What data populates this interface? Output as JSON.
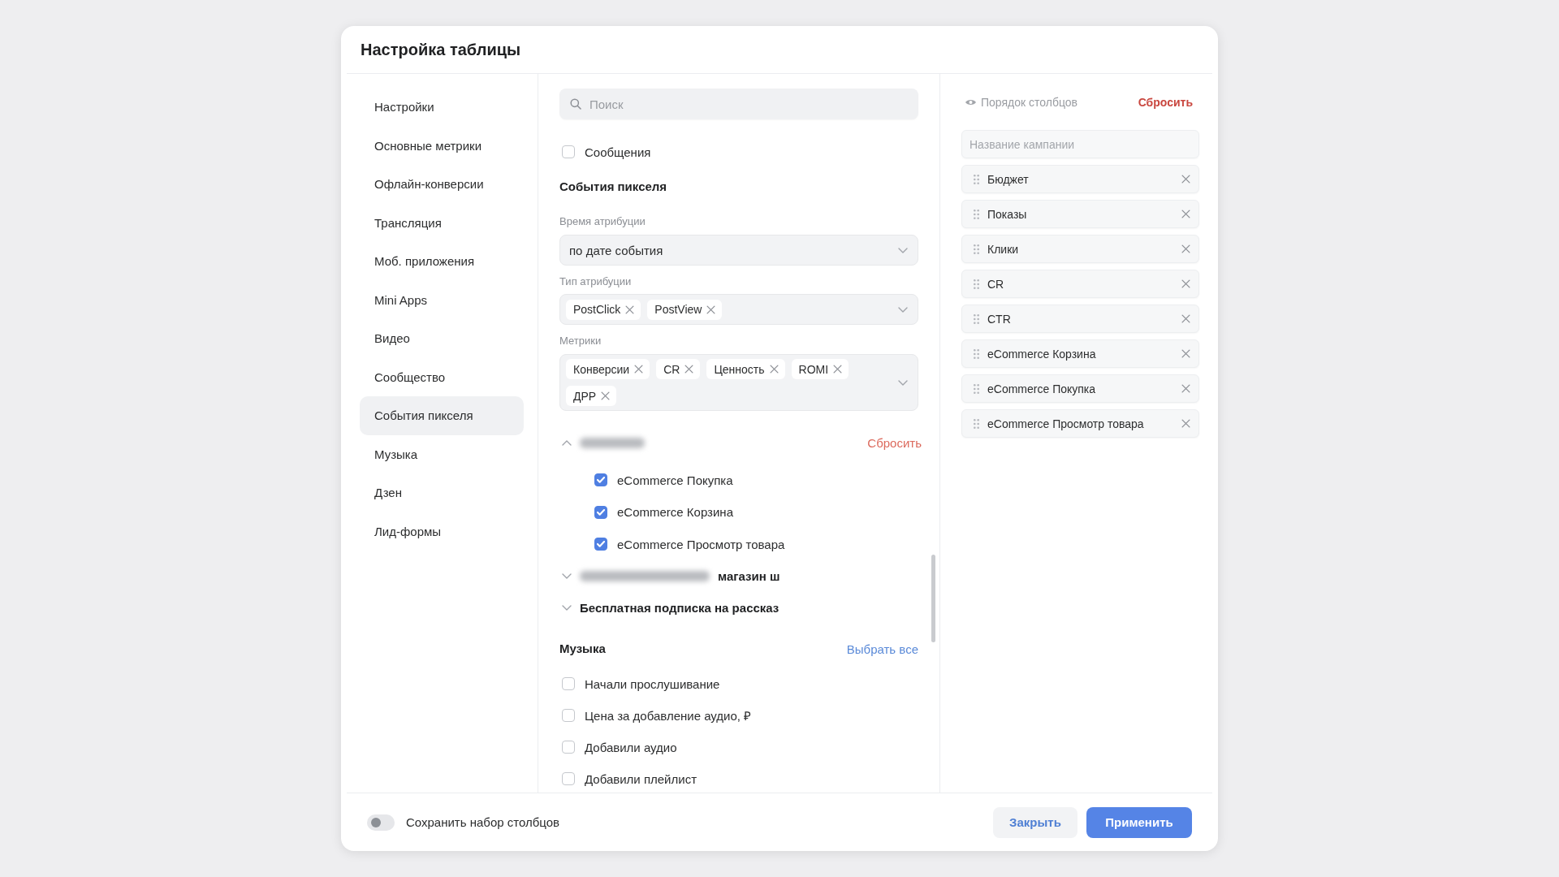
{
  "dialog": {
    "title": "Настройка таблицы"
  },
  "sidebar": {
    "items": [
      {
        "label": "Настройки",
        "selected": false
      },
      {
        "label": "Основные метрики",
        "selected": false
      },
      {
        "label": "Офлайн-конверсии",
        "selected": false
      },
      {
        "label": "Трансляция",
        "selected": false
      },
      {
        "label": "Моб. приложения",
        "selected": false
      },
      {
        "label": "Mini Apps",
        "selected": false
      },
      {
        "label": "Видео",
        "selected": false
      },
      {
        "label": "Сообщество",
        "selected": false
      },
      {
        "label": "События пикселя",
        "selected": true
      },
      {
        "label": "Музыка",
        "selected": false
      },
      {
        "label": "Дзен",
        "selected": false
      },
      {
        "label": "Лид-формы",
        "selected": false
      }
    ]
  },
  "content": {
    "search": {
      "placeholder": "Поиск"
    },
    "messages_option": {
      "label": "Сообщения",
      "checked": false
    },
    "pixel_events": {
      "title": "События пикселя",
      "attribution_time": {
        "label": "Время атрибуции",
        "value": "по дате события"
      },
      "attribution_type": {
        "label": "Тип атрибуции",
        "tags": [
          "PostClick",
          "PostView"
        ]
      },
      "metrics": {
        "label": "Метрики",
        "tags": [
          "Конверсии",
          "CR",
          "Ценность",
          "ROMI",
          "ДРР"
        ]
      },
      "groups": [
        {
          "redacted": true,
          "expanded": true,
          "reset_label": "Сбросить",
          "children": [
            {
              "label": "eCommerce Покупка",
              "checked": true
            },
            {
              "label": "eCommerce Корзина",
              "checked": true
            },
            {
              "label": "eCommerce Просмотр товара",
              "checked": true
            }
          ]
        },
        {
          "redacted": true,
          "title": "магазин ш",
          "expanded": false
        },
        {
          "redacted": false,
          "title": "Бесплатная подписка на рассказ",
          "expanded": false
        }
      ]
    },
    "music": {
      "title": "Музыка",
      "select_all": "Выбрать все",
      "items": [
        {
          "label": "Начали прослушивание",
          "checked": false
        },
        {
          "label": "Цена за добавление аудио, ₽",
          "checked": false
        },
        {
          "label": "Добавили аудио",
          "checked": false
        },
        {
          "label": "Добавили плейлист",
          "checked": false
        }
      ]
    }
  },
  "column_order": {
    "title": "Порядок столбцов",
    "reset": "Сбросить",
    "columns": [
      {
        "label": "Название кампании",
        "locked": true
      },
      {
        "label": "Бюджет",
        "locked": false
      },
      {
        "label": "Показы",
        "locked": false
      },
      {
        "label": "Клики",
        "locked": false
      },
      {
        "label": "CR",
        "locked": false
      },
      {
        "label": "CTR",
        "locked": false
      },
      {
        "label": "eCommerce Корзина",
        "locked": false
      },
      {
        "label": "eCommerce Покупка",
        "locked": false
      },
      {
        "label": "eCommerce Просмотр товара",
        "locked": false
      }
    ]
  },
  "footer": {
    "toggle": {
      "label": "Сохранить набор столбцов",
      "on": false
    },
    "buttons": [
      {
        "label": "Закрыть",
        "kind": "secondary"
      },
      {
        "label": "Применить",
        "kind": "primary"
      }
    ]
  }
}
